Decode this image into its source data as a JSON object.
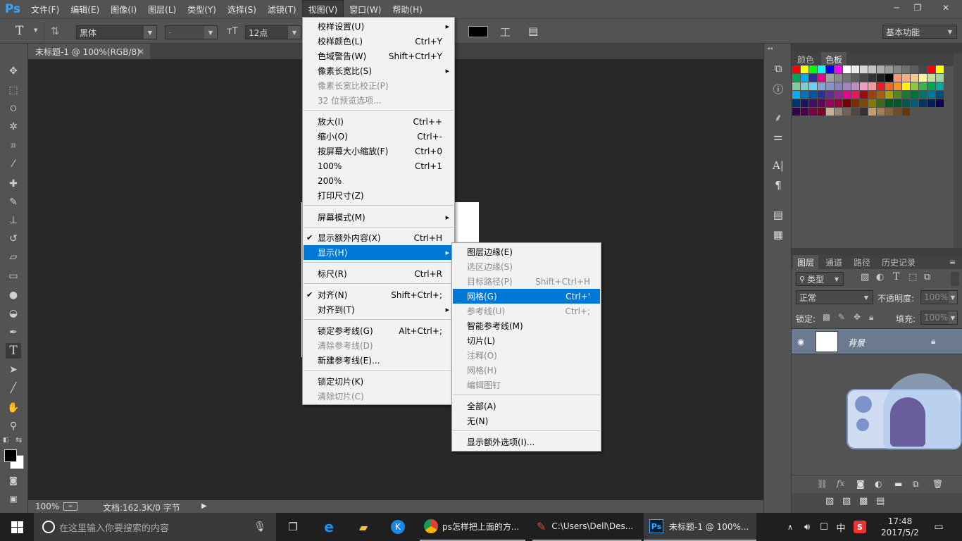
{
  "app": {
    "logo": "Ps"
  },
  "menubar": {
    "items": [
      "文件(F)",
      "编辑(E)",
      "图像(I)",
      "图层(L)",
      "类型(Y)",
      "选择(S)",
      "滤镜(T)",
      "视图(V)",
      "窗口(W)",
      "帮助(H)"
    ],
    "active_index": 7
  },
  "window_controls": {
    "minimize": "─",
    "restore": "❐",
    "close": "✕"
  },
  "options": {
    "tool_glyph": "T",
    "font_family": "黑体",
    "font_style": "-",
    "font_size": "12点",
    "workspace": "基本功能",
    "text_color": "#000000"
  },
  "document": {
    "tab_title": "未标题-1 @ 100%(RGB/8)",
    "tab_close": "×",
    "zoom": "100%",
    "doc_info": "文档:162.3K/0 字节"
  },
  "view_menu": {
    "items": [
      {
        "label": "校样设置(U)",
        "shortcut": "",
        "disabled": false,
        "submenu": true
      },
      {
        "label": "校样颜色(L)",
        "shortcut": "Ctrl+Y"
      },
      {
        "label": "色域警告(W)",
        "shortcut": "Shift+Ctrl+Y"
      },
      {
        "label": "像素长宽比(S)",
        "shortcut": "",
        "submenu": true
      },
      {
        "label": "像素长宽比校正(P)",
        "shortcut": "",
        "disabled": true
      },
      {
        "label": "32 位预览选项...",
        "shortcut": "",
        "disabled": true
      },
      {
        "label": "放大(I)",
        "shortcut": "Ctrl++"
      },
      {
        "label": "缩小(O)",
        "shortcut": "Ctrl+-"
      },
      {
        "label": "按屏幕大小缩放(F)",
        "shortcut": "Ctrl+0"
      },
      {
        "label": "100%",
        "shortcut": "Ctrl+1"
      },
      {
        "label": "200%",
        "shortcut": ""
      },
      {
        "label": "打印尺寸(Z)",
        "shortcut": ""
      },
      {
        "label": "屏幕模式(M)",
        "shortcut": "",
        "submenu": true
      },
      {
        "label": "显示额外内容(X)",
        "shortcut": "Ctrl+H",
        "checked": true
      },
      {
        "label": "显示(H)",
        "shortcut": "",
        "submenu": true,
        "highlighted": true
      },
      {
        "label": "标尺(R)",
        "shortcut": "Ctrl+R"
      },
      {
        "label": "对齐(N)",
        "shortcut": "Shift+Ctrl+;",
        "checked": true
      },
      {
        "label": "对齐到(T)",
        "shortcut": "",
        "submenu": true
      },
      {
        "label": "锁定参考线(G)",
        "shortcut": "Alt+Ctrl+;"
      },
      {
        "label": "清除参考线(D)",
        "shortcut": "",
        "disabled": true
      },
      {
        "label": "新建参考线(E)...",
        "shortcut": ""
      },
      {
        "label": "锁定切片(K)",
        "shortcut": ""
      },
      {
        "label": "清除切片(C)",
        "shortcut": "",
        "disabled": true
      }
    ]
  },
  "show_submenu": {
    "items": [
      {
        "label": "图层边缘(E)",
        "shortcut": ""
      },
      {
        "label": "选区边缘(S)",
        "shortcut": "",
        "disabled": true
      },
      {
        "label": "目标路径(P)",
        "shortcut": "Shift+Ctrl+H",
        "disabled": true
      },
      {
        "label": "网格(G)",
        "shortcut": "Ctrl+'",
        "highlighted": true
      },
      {
        "label": "参考线(U)",
        "shortcut": "Ctrl+;",
        "disabled": true
      },
      {
        "label": "智能参考线(M)",
        "shortcut": ""
      },
      {
        "label": "切片(L)",
        "shortcut": ""
      },
      {
        "label": "注释(O)",
        "shortcut": "",
        "disabled": true
      },
      {
        "label": "网格(H)",
        "shortcut": "",
        "disabled": true
      },
      {
        "label": "编辑图钉",
        "shortcut": "",
        "disabled": true
      },
      {
        "label": "全部(A)",
        "shortcut": ""
      },
      {
        "label": "无(N)",
        "shortcut": ""
      },
      {
        "label": "显示额外选项(I)...",
        "shortcut": ""
      }
    ]
  },
  "swatch_panel": {
    "tabs": [
      "颜色",
      "色板"
    ],
    "active_tab": 1,
    "colors": [
      "#ff0000",
      "#ffff00",
      "#00ff00",
      "#00ffff",
      "#0000ff",
      "#ff00ff",
      "#ffffff",
      "#ebebeb",
      "#d6d6d6",
      "#c2c2c2",
      "#adadad",
      "#999999",
      "#858585",
      "#707070",
      "#5c5c5c",
      "#474747",
      "#ff0000",
      "#ffff00",
      "#00a651",
      "#00aeef",
      "#2e3192",
      "#ec008c",
      "#a1a1a1",
      "#8a8a8a",
      "#737373",
      "#5e5e5e",
      "#474747",
      "#333333",
      "#1f1f1f",
      "#000000",
      "#f7977a",
      "#f9ad81",
      "#fdc68a",
      "#fff79a",
      "#c4df9b",
      "#a3d39c",
      "#82ca9d",
      "#7bcdc8",
      "#6ecff6",
      "#7ea7d8",
      "#8493ca",
      "#8882be",
      "#a187be",
      "#bc8dbf",
      "#f49ac2",
      "#f6989d",
      "#ed1c24",
      "#f26522",
      "#f7941d",
      "#fff200",
      "#8dc63f",
      "#39b54a",
      "#00a651",
      "#00a99d",
      "#00aeef",
      "#0072bc",
      "#0054a6",
      "#2e3192",
      "#662d91",
      "#92278f",
      "#ec008c",
      "#ed145b",
      "#9e0b0f",
      "#a0410d",
      "#a3620a",
      "#aba000",
      "#598527",
      "#197b30",
      "#007236",
      "#00746b",
      "#0076a3",
      "#004b80",
      "#003471",
      "#1b1464",
      "#440e62",
      "#630460",
      "#9e005d",
      "#9e0039",
      "#790000",
      "#7b2e00",
      "#7d4900",
      "#827b00",
      "#406618",
      "#005e20",
      "#005826",
      "#005952",
      "#005b7f",
      "#003663",
      "#002157",
      "#0d004c",
      "#32004b",
      "#4b0049",
      "#7b0046",
      "#7a0026",
      "#c7b299",
      "#998675",
      "#736357",
      "#534741",
      "#37302d",
      "#c69c6d",
      "#a67c52",
      "#8c6239",
      "#754c24",
      "#603913"
    ]
  },
  "layers_panel": {
    "tabs": [
      "图层",
      "通道",
      "路径",
      "历史记录"
    ],
    "active_tab": 0,
    "filter_kind": "类型",
    "blend_mode": "正常",
    "opacity_label": "不透明度:",
    "opacity_value": "100%",
    "lock_label": "锁定:",
    "fill_label": "填充:",
    "fill_value": "100%",
    "layer_name": "背景"
  },
  "taskbar": {
    "search_placeholder": "在这里输入你要搜索的内容",
    "apps": [
      {
        "label": "ps怎样把上面的方..."
      },
      {
        "label": "C:\\Users\\Dell\\Des..."
      },
      {
        "label": "未标题-1 @ 100%..."
      }
    ],
    "ime": "中",
    "time": "17:48",
    "date": "2017/5/2"
  }
}
